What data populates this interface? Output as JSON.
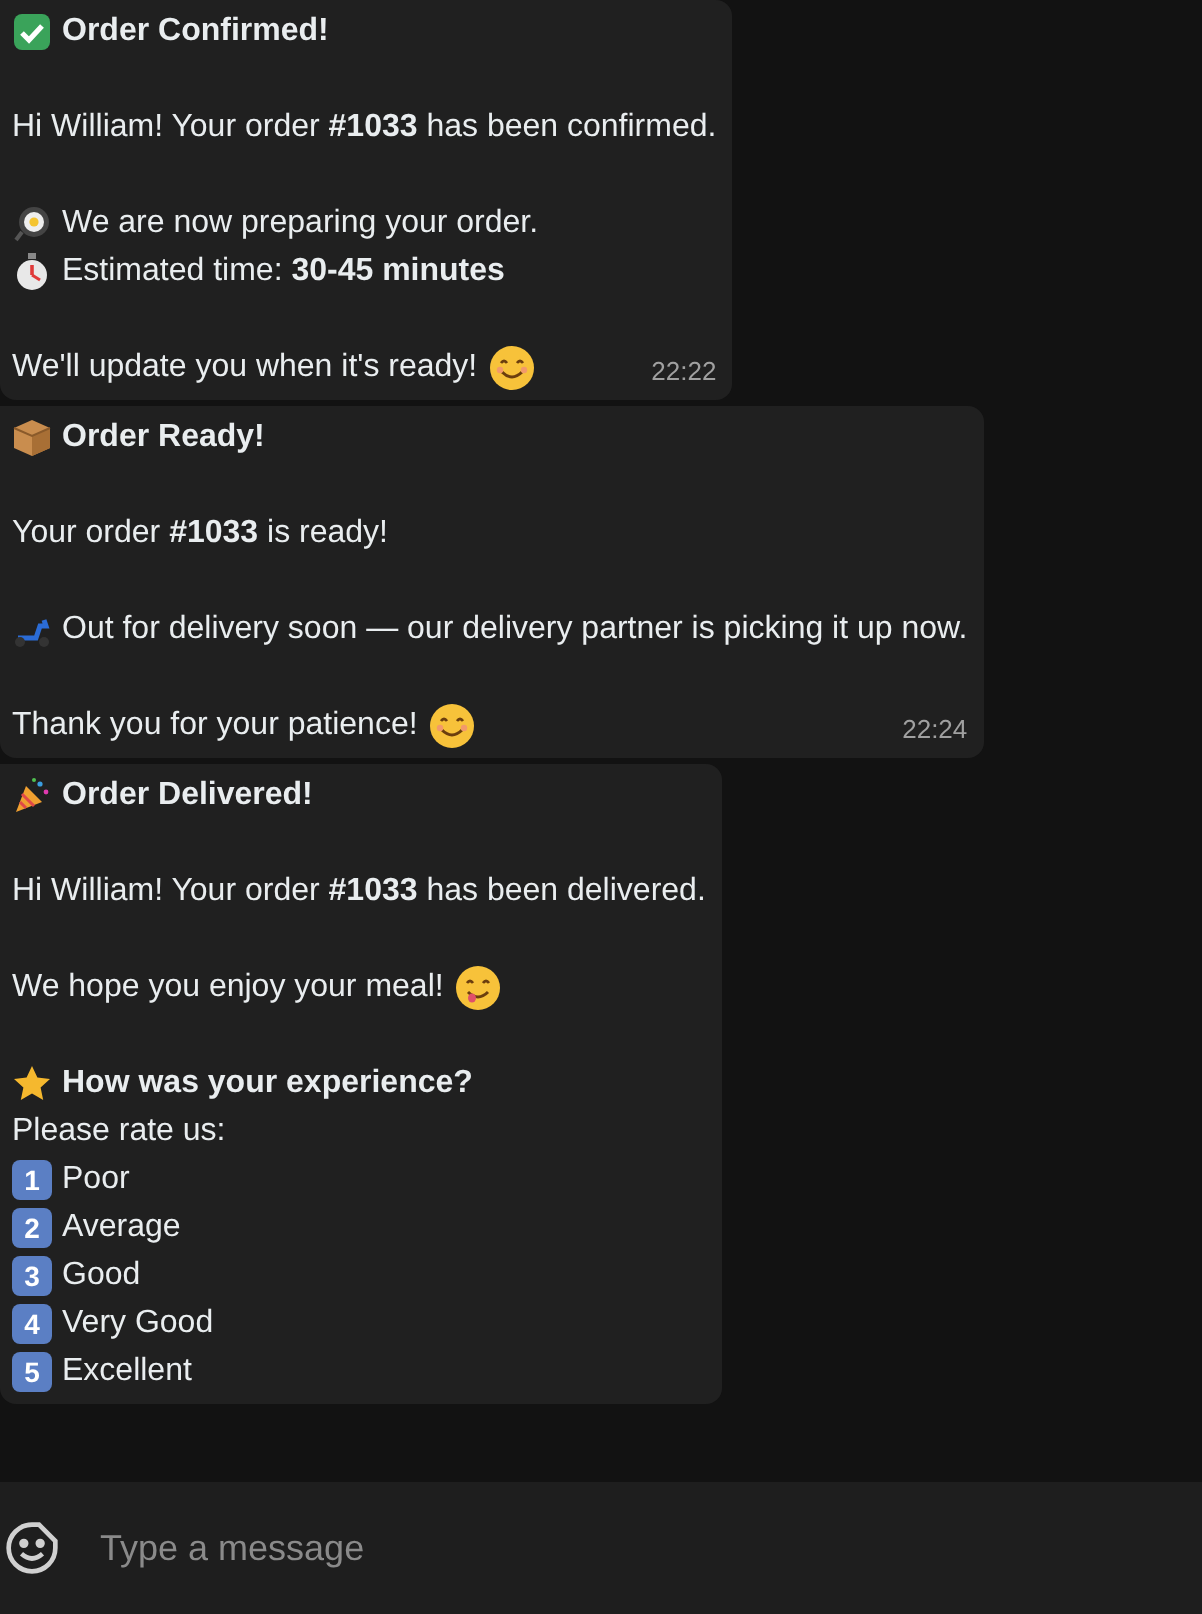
{
  "messages": [
    {
      "blocks": [
        [
          {
            "kind": "title",
            "text": "Order Confirmed!"
          }
        ],
        [
          {
            "kind": "text",
            "text": "Hi William! Your order **#1033** has been confirmed."
          }
        ],
        [
          {
            "kind": "text",
            "text": "We are now preparing your order."
          },
          {
            "kind": "text",
            "text": "Estimated time: **30-45 minutes**"
          }
        ],
        [
          {
            "kind": "closing",
            "text": "We'll update you when it's ready!"
          }
        ]
      ],
      "time": "22:22"
    },
    {
      "blocks": [
        [
          {
            "kind": "title",
            "text": "Order Ready!"
          }
        ],
        [
          {
            "kind": "text",
            "text": "Your order **#1033** is ready!"
          }
        ],
        [
          {
            "kind": "text",
            "text": "Out for delivery soon — our delivery partner is picking it up now."
          }
        ],
        [
          {
            "kind": "closing",
            "text": "Thank you for your patience!"
          }
        ]
      ],
      "time": "22:24"
    },
    {
      "blocks": [
        [
          {
            "kind": "title",
            "text": "Order Delivered!"
          }
        ],
        [
          {
            "kind": "text",
            "text": "Hi William! Your order **#1033** has been delivered."
          }
        ],
        [
          {
            "kind": "closing",
            "text": "We hope you enjoy your meal!"
          }
        ],
        [
          {
            "kind": "title",
            "text": "How was your experience?"
          },
          {
            "kind": "text",
            "text": "Please rate us:"
          },
          {
            "kind": "option",
            "number": "1",
            "text": "Poor"
          },
          {
            "kind": "option",
            "number": "2",
            "text": "Average"
          },
          {
            "kind": "option",
            "number": "3",
            "text": "Good"
          },
          {
            "kind": "option",
            "number": "4",
            "text": "Very Good"
          },
          {
            "kind": "option",
            "number": "5",
            "text": "Excellent"
          }
        ]
      ]
    }
  ],
  "composer": {
    "placeholder": "Type a message"
  }
}
